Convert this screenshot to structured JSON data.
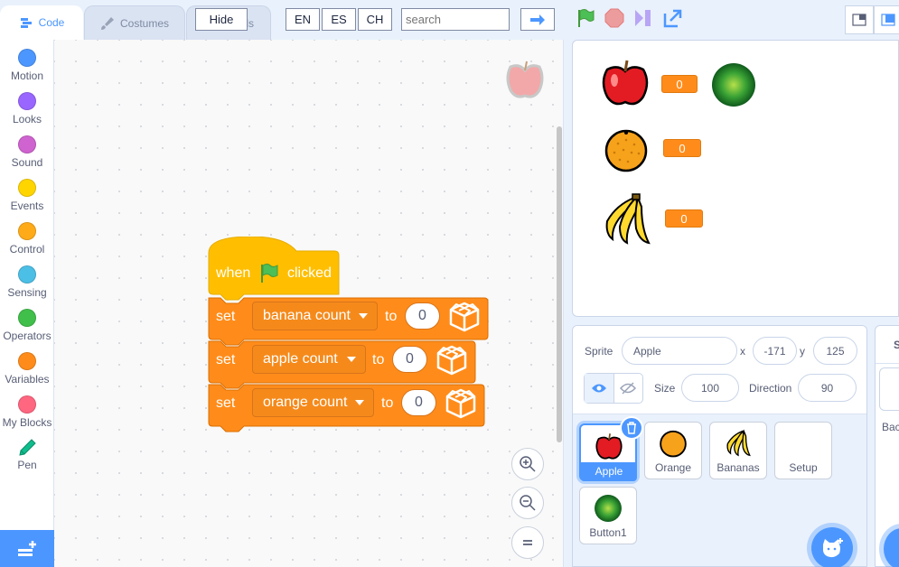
{
  "tabs": [
    {
      "label": "Code",
      "active": true
    },
    {
      "label": "Costumes",
      "active": false
    },
    {
      "label": "Sounds",
      "active": false
    }
  ],
  "toolbar": {
    "hide_label": "Hide",
    "languages": [
      "EN",
      "ES",
      "CH"
    ],
    "search_placeholder": "search",
    "go_icon": "arrow-right-icon"
  },
  "controls": {
    "green_flag": "green-flag-icon",
    "stop": "stop-icon",
    "turbo": "turbo-icon",
    "fullscreen": "fullscreen-icon"
  },
  "categories": [
    {
      "label": "Motion",
      "color": "#4c97ff"
    },
    {
      "label": "Looks",
      "color": "#9966ff"
    },
    {
      "label": "Sound",
      "color": "#cf63cf"
    },
    {
      "label": "Events",
      "color": "#ffd500"
    },
    {
      "label": "Control",
      "color": "#ffab19"
    },
    {
      "label": "Sensing",
      "color": "#4cbfe6"
    },
    {
      "label": "Operators",
      "color": "#40bf4a"
    },
    {
      "label": "Variables",
      "color": "#ff8c1a"
    },
    {
      "label": "My Blocks",
      "color": "#ff6680"
    },
    {
      "label": "Pen",
      "color": "pen-icon"
    }
  ],
  "script": {
    "hat": {
      "when": "when",
      "clicked": "clicked"
    },
    "set_blocks": [
      {
        "set": "set",
        "variable": "banana count",
        "to": "to",
        "value": "0"
      },
      {
        "set": "set",
        "variable": "apple count",
        "to": "to",
        "value": "0"
      },
      {
        "set": "set",
        "variable": "orange count",
        "to": "to",
        "value": "0"
      }
    ]
  },
  "stage": {
    "monitors": [
      {
        "sprite": "apple",
        "value": "0"
      },
      {
        "sprite": "orange",
        "value": "0"
      },
      {
        "sprite": "banana",
        "value": "0"
      }
    ]
  },
  "sprite_info": {
    "sprite_label": "Sprite",
    "sprite_name": "Apple",
    "x_label": "x",
    "x_value": "-171",
    "y_label": "y",
    "y_value": "125",
    "size_label": "Size",
    "size_value": "100",
    "direction_label": "Direction",
    "direction_value": "90"
  },
  "sprites": [
    {
      "name": "Apple",
      "selected": true
    },
    {
      "name": "Orange",
      "selected": false
    },
    {
      "name": "Bananas",
      "selected": false
    },
    {
      "name": "Setup",
      "selected": false
    },
    {
      "name": "Button1",
      "selected": false
    }
  ],
  "stage_pane": {
    "header": "St",
    "backdrops_label": "Bac"
  },
  "colors": {
    "accent": "#4c97ff",
    "events_block": "#ffbf00",
    "variables_block": "#ff8c1a"
  }
}
